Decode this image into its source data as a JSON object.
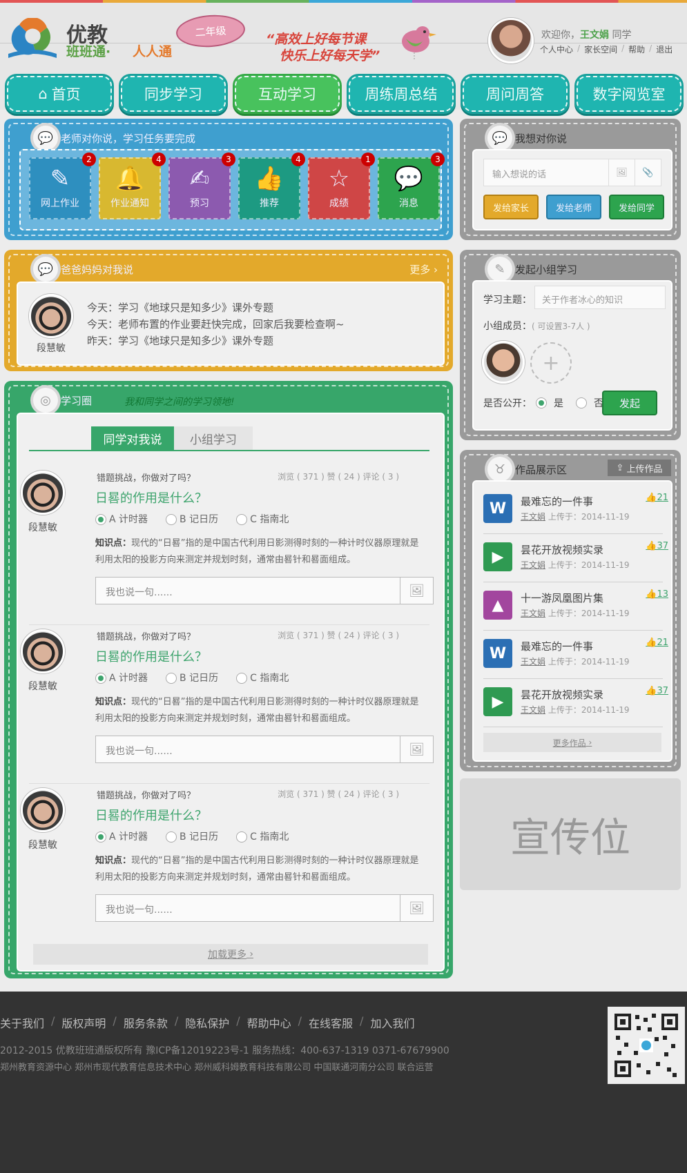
{
  "header": {
    "logo_title": "优教",
    "logo_sub1": "班班通·",
    "logo_sub2": "人人通",
    "grade": "二年级",
    "slogan1": "“高效上好每节课",
    "slogan2": "快乐上好每天学”",
    "welcome_prefix": "欢迎你，",
    "user_name": "王文娟",
    "welcome_suffix": "同学",
    "links": [
      "个人中心",
      "家长空间",
      "帮助",
      "退出"
    ]
  },
  "nav": [
    {
      "label": "首页",
      "icon": "home-icon"
    },
    {
      "label": "同步学习"
    },
    {
      "label": "互动学习",
      "active": true
    },
    {
      "label": "周练周总结"
    },
    {
      "label": "周问周答"
    },
    {
      "label": "数字阅览室"
    }
  ],
  "teacher_panel": {
    "title": "老师对你说，学习任务要完成",
    "tiles": [
      {
        "label": "网上作业",
        "count": "2",
        "color": "#2e8fbf",
        "icon": "pencil-icon"
      },
      {
        "label": "作业通知",
        "count": "4",
        "color": "#d8b830",
        "icon": "bell-icon"
      },
      {
        "label": "预习",
        "count": "3",
        "color": "#8c5aaf",
        "icon": "edit-icon"
      },
      {
        "label": "推荐",
        "count": "4",
        "color": "#1d9a82",
        "icon": "thumbs-up-icon"
      },
      {
        "label": "成绩",
        "count": "1",
        "color": "#cf4646",
        "icon": "star-icon"
      },
      {
        "label": "消息",
        "count": "3",
        "color": "#2da44e",
        "icon": "chat-icon"
      }
    ]
  },
  "parent_panel": {
    "title": "爸爸妈妈对我说",
    "more": "更多",
    "name": "段慧敏",
    "messages": [
      {
        "day": "今天：",
        "text": "学习《地球只是知多少》课外专题"
      },
      {
        "day": "今天：",
        "text": "老师布置的作业要赶快完成，回家后我要检查啊~"
      },
      {
        "day": "昨天：",
        "text": "学习《地球只是知多少》课外专题"
      }
    ]
  },
  "study_circle": {
    "title": "学习圈",
    "slogan": "我和同学之间的学习领地!",
    "tabs": [
      "同学对我说",
      "小组学习"
    ],
    "items": [
      {
        "name": "段慧敏",
        "title": "错题挑战，你做对了吗？",
        "stats": "浏览 ( 371 )   赞 ( 24 )   评论 ( 3 )",
        "question": "日晷的作用是什么？",
        "options": [
          "A 计时器",
          "B 记日历",
          "C 指南北"
        ],
        "knowledge_label": "知识点：",
        "knowledge": "现代的“日晷”指的是中国古代利用日影测得时刻的一种计时仪器原理就是利用太阳的投影方向来测定并规划时刻，通常由晷针和晷面组成。",
        "input_placeholder": "我也说一句......"
      },
      {
        "name": "段慧敏",
        "title": "错题挑战，你做对了吗？",
        "stats": "浏览 ( 371 )   赞 ( 24 )   评论 ( 3 )",
        "question": "日晷的作用是什么？",
        "options": [
          "A 计时器",
          "B 记日历",
          "C 指南北"
        ],
        "knowledge_label": "知识点：",
        "knowledge": "现代的“日晷”指的是中国古代利用日影测得时刻的一种计时仪器原理就是利用太阳的投影方向来测定并规划时刻，通常由晷针和晷面组成。",
        "input_placeholder": "我也说一句......"
      },
      {
        "name": "段慧敏",
        "title": "错题挑战，你做对了吗？",
        "stats": "浏览 ( 371 )   赞 ( 24 )   评论 ( 3 )",
        "question": "日晷的作用是什么？",
        "options": [
          "A 计时器",
          "B 记日历",
          "C 指南北"
        ],
        "knowledge_label": "知识点：",
        "knowledge": "现代的“日晷”指的是中国古代利用日影测得时刻的一种计时仪器原理就是利用太阳的投影方向来测定并规划时刻，通常由晷针和晷面组成。",
        "input_placeholder": "我也说一句......"
      }
    ],
    "load_more": "加载更多"
  },
  "say_panel": {
    "title": "我想对你说",
    "placeholder": "输入想说的话",
    "buttons": [
      "发给家长",
      "发给老师",
      "发给同学"
    ]
  },
  "group_panel": {
    "title": "发起小组学习",
    "topic_label": "学习主题：",
    "topic_placeholder": "关于作者冰心的知识",
    "members_label": "小组成员：",
    "members_hint": "( 可设置3-7人 )",
    "public_label": "是否公开：",
    "yes": "是",
    "no": "否",
    "start": "发起"
  },
  "works_panel": {
    "title": "作品展示区",
    "upload": "上传作品",
    "items": [
      {
        "title": "最难忘的一件事",
        "author": "王文娟",
        "meta": " 上传于：2014-11-19",
        "likes": "21",
        "kind": "W",
        "color": "#2b6fb4"
      },
      {
        "title": "昙花开放视频实录",
        "author": "王文娟",
        "meta": " 上传于：2014-11-19",
        "likes": "37",
        "kind": "▶",
        "color": "#2f9a52"
      },
      {
        "title": "十一游凤凰图片集",
        "author": "王文娟",
        "meta": " 上传于：2014-11-19",
        "likes": "13",
        "kind": "▲",
        "color": "#a2469e"
      },
      {
        "title": "最难忘的一件事",
        "author": "王文娟",
        "meta": " 上传于：2014-11-19",
        "likes": "21",
        "kind": "W",
        "color": "#2b6fb4"
      },
      {
        "title": "昙花开放视频实录",
        "author": "王文娟",
        "meta": " 上传于：2014-11-19",
        "likes": "37",
        "kind": "▶",
        "color": "#2f9a52"
      }
    ],
    "more": "更多作品"
  },
  "ad": {
    "label": "宣传位"
  },
  "footer": {
    "links": [
      "关于我们",
      "版权声明",
      "服务条款",
      "隐私保护",
      "帮助中心",
      "在线客服",
      "加入我们"
    ],
    "copyright": "2012-2015 优教班班通版权所有  豫ICP备12019223号-1     服务热线：400-637-1319   0371-67679900",
    "operators": "郑州教育资源中心    郑州市现代教育信息技术中心   郑州威科姆教育科技有限公司 中国联通河南分公司  联合运营"
  }
}
